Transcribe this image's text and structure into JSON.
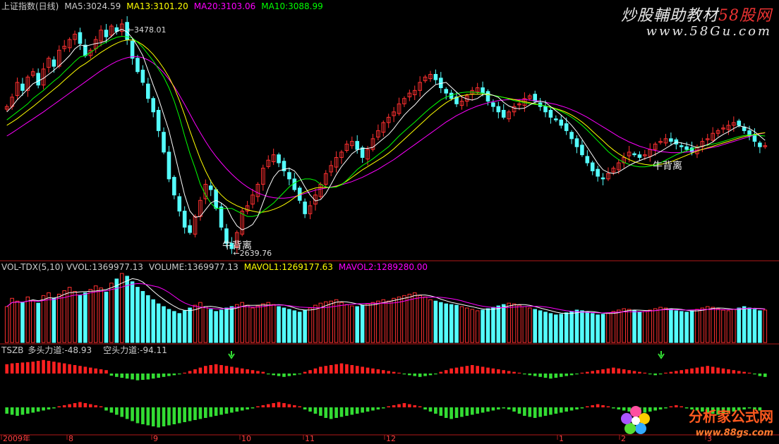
{
  "colors": {
    "up": "#ff3030",
    "down": "#54fcfc",
    "ma5": "#ffffff",
    "ma10": "#00ff00",
    "ma13": "#ffff00",
    "ma20": "#ff00ff",
    "bull": "#ff2020",
    "bear": "#33dd33",
    "arrow": "#33dd33",
    "separator": "#b01818"
  },
  "main_header": {
    "title": "上证指数(日线)",
    "ma5": "MA5:3024.59",
    "ma13": "MA13:3101.20",
    "ma20": "MA20:3103.06",
    "ma10": "MA10:3088.99"
  },
  "annotations": {
    "high": "3478.01",
    "low": "2639.76",
    "bull_div_1": "牛背离",
    "bull_div_2": "牛背离"
  },
  "vol_header": {
    "name": "VOL-TDX(5,10)",
    "vvol": "VVOL:1369977.13",
    "volume": "VOLUME:1369977.13",
    "mavol1": "MAVOL1:1269177.63",
    "mavol2": "MAVOL2:1289280.00"
  },
  "tszb_header": {
    "name": "TSZB",
    "bull": "多头力道:-48.93",
    "bear": "空头力道:-94.11"
  },
  "x_axis": {
    "labels": [
      "2009年",
      "8",
      "9",
      "10",
      "11",
      "12",
      "1",
      "2",
      "3"
    ]
  },
  "watermarks": {
    "brand_top": "炒股輔助教材",
    "brand_top_red": "58股网",
    "url_top": "www.58Gu.com",
    "brand_bottom": "分析家公式网",
    "url_bottom": "www.88gs.com"
  },
  "chart_data": {
    "type": "candlestick",
    "ylim": [
      2600,
      3520
    ],
    "high_point": 3478.01,
    "low_point": 2639.76,
    "closes": [
      3170,
      3205,
      3260,
      3230,
      3280,
      3300,
      3250,
      3310,
      3350,
      3320,
      3380,
      3395,
      3420,
      3440,
      3405,
      3360,
      3380,
      3420,
      3455,
      3430,
      3470,
      3450,
      3478,
      3420,
      3350,
      3300,
      3260,
      3200,
      3150,
      3080,
      3000,
      2900,
      2840,
      2780,
      2720,
      2700,
      2760,
      2820,
      2880,
      2860,
      2790,
      2720,
      2660,
      2640,
      2700,
      2780,
      2800,
      2840,
      2880,
      2940,
      2970,
      2990,
      2960,
      2930,
      2900,
      2860,
      2820,
      2770,
      2800,
      2840,
      2880,
      2920,
      2950,
      2980,
      3000,
      3030,
      3040,
      3010,
      2980,
      3010,
      3050,
      3080,
      3110,
      3130,
      3150,
      3180,
      3200,
      3220,
      3230,
      3260,
      3280,
      3290,
      3270,
      3240,
      3220,
      3200,
      3180,
      3190,
      3210,
      3230,
      3240,
      3220,
      3190,
      3170,
      3150,
      3130,
      3150,
      3170,
      3180,
      3200,
      3210,
      3190,
      3170,
      3150,
      3130,
      3120,
      3100,
      3080,
      3050,
      3020,
      2990,
      2960,
      2930,
      2910,
      2900,
      2920,
      2940,
      2960,
      2980,
      3000,
      2990,
      2980,
      2990,
      3010,
      3030,
      3040,
      3050,
      3040,
      3030,
      3020,
      3010,
      3000,
      3020,
      3040,
      3050,
      3070,
      3080,
      3090,
      3100,
      3110,
      3100,
      3080,
      3060,
      3040,
      3020,
      3024
    ],
    "ma5": [
      3150,
      3170,
      3195,
      3215,
      3235,
      3255,
      3265,
      3275,
      3290,
      3305,
      3322,
      3340,
      3360,
      3385,
      3400,
      3395,
      3400,
      3405,
      3408,
      3415,
      3432,
      3450,
      3458,
      3448,
      3425,
      3395,
      3360,
      3305,
      3250,
      3200,
      3140,
      3080,
      3000,
      2920,
      2840,
      2780,
      2757,
      2760,
      2785,
      2810,
      2820,
      2810,
      2795,
      2755,
      2725,
      2710,
      2718,
      2730,
      2760,
      2812,
      2865,
      2906,
      2930,
      2936,
      2940,
      2930,
      2905,
      2870,
      2840,
      2818,
      2823,
      2846,
      2880,
      2916,
      2946,
      2970,
      2994,
      3008,
      3014,
      3014,
      3018,
      3034,
      3050,
      3066,
      3088,
      3114,
      3138,
      3158,
      3176,
      3198,
      3218,
      3235,
      3252,
      3256,
      3260,
      3242,
      3224,
      3206,
      3198,
      3194,
      3200,
      3214,
      3218,
      3212,
      3204,
      3186,
      3172,
      3164,
      3162,
      3164,
      3176,
      3186,
      3190,
      3186,
      3170,
      3154,
      3138,
      3120,
      3100,
      3076,
      3048,
      3018,
      2988,
      2958,
      2934,
      2924,
      2920,
      2926,
      2938,
      2950,
      2960,
      2968,
      2976,
      2982,
      2992,
      3002,
      3014,
      3026,
      3038,
      3034,
      3030,
      3024,
      3016,
      3022,
      3028,
      3038,
      3054,
      3066,
      3076,
      3088,
      3098,
      3094,
      3088,
      3076,
      3060,
      3044
    ],
    "ma10": [
      3120,
      3135,
      3150,
      3165,
      3180,
      3200,
      3215,
      3230,
      3248,
      3265,
      3280,
      3300,
      3318,
      3338,
      3355,
      3360,
      3372,
      3385,
      3400,
      3410,
      3420,
      3428,
      3432,
      3430,
      3425,
      3410,
      3390,
      3365,
      3340,
      3310,
      3280,
      3240,
      3190,
      3130,
      3060,
      2995,
      2940,
      2880,
      2840,
      2810,
      2790,
      2790,
      2790,
      2790,
      2780,
      2770,
      2760,
      2760,
      2765,
      2780,
      2795,
      2810,
      2830,
      2850,
      2870,
      2885,
      2895,
      2900,
      2900,
      2895,
      2880,
      2870,
      2868,
      2870,
      2878,
      2895,
      2915,
      2935,
      2950,
      2962,
      2975,
      2990,
      3005,
      3020,
      3040,
      3060,
      3078,
      3095,
      3112,
      3130,
      3148,
      3165,
      3180,
      3195,
      3205,
      3212,
      3218,
      3222,
      3224,
      3224,
      3222,
      3220,
      3216,
      3212,
      3208,
      3204,
      3198,
      3192,
      3188,
      3184,
      3180,
      3178,
      3176,
      3172,
      3166,
      3160,
      3152,
      3142,
      3130,
      3116,
      3100,
      3082,
      3062,
      3042,
      3022,
      3002,
      2986,
      2972,
      2962,
      2954,
      2948,
      2945,
      2945,
      2948,
      2952,
      2960,
      2970,
      2980,
      2990,
      2998,
      3006,
      3012,
      3018,
      3022,
      3026,
      3030,
      3034,
      3040,
      3046,
      3052,
      3058,
      3062,
      3064,
      3064,
      3062,
      3060
    ],
    "ma13": [
      3100,
      3112,
      3125,
      3140,
      3155,
      3170,
      3186,
      3202,
      3218,
      3234,
      3250,
      3268,
      3285,
      3302,
      3318,
      3330,
      3344,
      3358,
      3372,
      3384,
      3396,
      3406,
      3414,
      3418,
      3418,
      3412,
      3400,
      3384,
      3364,
      3340,
      3312,
      3280,
      3240,
      3192,
      3138,
      3080,
      3026,
      2974,
      2930,
      2892,
      2862,
      2840,
      2822,
      2810,
      2800,
      2792,
      2785,
      2780,
      2776,
      2776,
      2780,
      2786,
      2794,
      2804,
      2816,
      2830,
      2842,
      2852,
      2860,
      2866,
      2868,
      2868,
      2868,
      2872,
      2880,
      2892,
      2906,
      2920,
      2934,
      2946,
      2958,
      2970,
      2982,
      2996,
      3012,
      3030,
      3048,
      3066,
      3084,
      3102,
      3120,
      3138,
      3154,
      3170,
      3184,
      3196,
      3204,
      3210,
      3214,
      3216,
      3216,
      3216,
      3214,
      3212,
      3208,
      3204,
      3200,
      3196,
      3192,
      3188,
      3184,
      3180,
      3176,
      3172,
      3168,
      3162,
      3156,
      3148,
      3138,
      3126,
      3112,
      3096,
      3078,
      3060,
      3042,
      3024,
      3008,
      2994,
      2982,
      2972,
      2964,
      2958,
      2954,
      2952,
      2952,
      2954,
      2958,
      2964,
      2972,
      2980,
      2988,
      2996,
      3004,
      3010,
      3016,
      3022,
      3028,
      3034,
      3040,
      3046,
      3052,
      3058,
      3062,
      3066,
      3070,
      3072
    ],
    "ma20": [
      3060,
      3072,
      3085,
      3098,
      3111,
      3124,
      3137,
      3150,
      3164,
      3178,
      3192,
      3206,
      3220,
      3234,
      3248,
      3262,
      3276,
      3290,
      3304,
      3316,
      3328,
      3338,
      3346,
      3352,
      3356,
      3356,
      3352,
      3344,
      3332,
      3316,
      3296,
      3272,
      3244,
      3212,
      3178,
      3142,
      3106,
      3072,
      3040,
      3010,
      2984,
      2960,
      2938,
      2918,
      2900,
      2884,
      2870,
      2858,
      2848,
      2840,
      2834,
      2830,
      2828,
      2828,
      2830,
      2834,
      2840,
      2846,
      2852,
      2858,
      2862,
      2866,
      2870,
      2874,
      2878,
      2884,
      2890,
      2898,
      2906,
      2916,
      2926,
      2936,
      2948,
      2960,
      2972,
      2986,
      3000,
      3014,
      3028,
      3042,
      3056,
      3070,
      3084,
      3098,
      3112,
      3124,
      3136,
      3146,
      3156,
      3164,
      3172,
      3178,
      3184,
      3188,
      3192,
      3194,
      3196,
      3196,
      3196,
      3196,
      3194,
      3192,
      3190,
      3186,
      3182,
      3178,
      3172,
      3166,
      3158,
      3150,
      3140,
      3130,
      3118,
      3106,
      3094,
      3082,
      3070,
      3058,
      3048,
      3038,
      3030,
      3022,
      3016,
      3010,
      3006,
      3002,
      3000,
      2998,
      2998,
      2998,
      3000,
      3002,
      3006,
      3010,
      3014,
      3018,
      3022,
      3028,
      3034,
      3040,
      3046,
      3052,
      3058,
      3064,
      3068,
      3072
    ],
    "volume": [
      52,
      64,
      60,
      58,
      66,
      61,
      57,
      68,
      72,
      64,
      70,
      75,
      80,
      74,
      68,
      72,
      77,
      82,
      79,
      73,
      86,
      92,
      100,
      96,
      88,
      80,
      74,
      68,
      62,
      56,
      52,
      48,
      45,
      42,
      46,
      50,
      54,
      58,
      52,
      48,
      45,
      47,
      50,
      52,
      55,
      58,
      54,
      50,
      53,
      56,
      58,
      55,
      52,
      50,
      48,
      46,
      44,
      47,
      50,
      54,
      57,
      59,
      60,
      62,
      58,
      55,
      53,
      52,
      54,
      56,
      58,
      60,
      62,
      60,
      64,
      66,
      68,
      70,
      72,
      68,
      66,
      62,
      60,
      58,
      56,
      55,
      54,
      52,
      50,
      48,
      46,
      47,
      49,
      51,
      53,
      55,
      57,
      56,
      54,
      52,
      50,
      48,
      46,
      44,
      42,
      40,
      41,
      43,
      45,
      47,
      46,
      44,
      42,
      40,
      41,
      43,
      45,
      47,
      49,
      48,
      46,
      44,
      45,
      47,
      49,
      51,
      50,
      48,
      46,
      45,
      44,
      46,
      48,
      50,
      52,
      51,
      49,
      47,
      46,
      48,
      50,
      52,
      50,
      48,
      46,
      47
    ],
    "bull_force": [
      22,
      24,
      25,
      26,
      27,
      28,
      30,
      32,
      30,
      28,
      26,
      24,
      22,
      20,
      18,
      16,
      14,
      12,
      10,
      8,
      -5,
      -8,
      -10,
      -12,
      -14,
      -16,
      -15,
      -14,
      -12,
      -10,
      -8,
      -6,
      -4,
      -2,
      2,
      6,
      10,
      14,
      18,
      20,
      22,
      20,
      18,
      16,
      14,
      12,
      10,
      8,
      6,
      4,
      -2,
      -4,
      -6,
      -8,
      -6,
      -4,
      -2,
      4,
      8,
      12,
      16,
      18,
      20,
      22,
      24,
      22,
      20,
      18,
      16,
      14,
      12,
      10,
      8,
      6,
      4,
      2,
      -2,
      -4,
      -6,
      -8,
      -6,
      -4,
      -2,
      4,
      8,
      12,
      14,
      16,
      18,
      20,
      18,
      16,
      14,
      12,
      10,
      8,
      6,
      4,
      2,
      -2,
      -4,
      -6,
      -8,
      -10,
      -12,
      -10,
      -8,
      -6,
      -4,
      -2,
      2,
      4,
      6,
      8,
      10,
      12,
      14,
      12,
      10,
      8,
      6,
      4,
      2,
      -2,
      -4,
      -2,
      2,
      4,
      6,
      8,
      10,
      12,
      14,
      16,
      18,
      16,
      14,
      12,
      10,
      8,
      6,
      4,
      2,
      -2,
      -6,
      -8,
      -10
    ],
    "bear_force": [
      -12,
      -14,
      -16,
      -14,
      -12,
      -10,
      -8,
      -6,
      -4,
      -2,
      2,
      4,
      6,
      8,
      10,
      8,
      6,
      4,
      2,
      -6,
      -10,
      -14,
      -18,
      -22,
      -26,
      -30,
      -32,
      -34,
      -36,
      -38,
      -36,
      -34,
      -32,
      -30,
      -28,
      -26,
      -24,
      -22,
      -20,
      -18,
      -16,
      -14,
      -12,
      -10,
      -8,
      -6,
      -4,
      -2,
      2,
      4,
      6,
      8,
      10,
      8,
      6,
      4,
      2,
      -4,
      -8,
      -12,
      -16,
      -20,
      -22,
      -20,
      -18,
      -16,
      -14,
      -12,
      -10,
      -8,
      -6,
      -4,
      -2,
      2,
      4,
      6,
      8,
      6,
      4,
      2,
      -4,
      -8,
      -12,
      -16,
      -20,
      -22,
      -20,
      -18,
      -16,
      -14,
      -12,
      -10,
      -8,
      -6,
      -4,
      -2,
      -4,
      -8,
      -12,
      -16,
      -18,
      -20,
      -18,
      -16,
      -14,
      -12,
      -10,
      -8,
      -6,
      -4,
      -2,
      2,
      4,
      6,
      4,
      2,
      -2,
      -4,
      -6,
      -8,
      -10,
      -12,
      -10,
      -8,
      -6,
      -4,
      -2,
      2,
      4,
      2,
      -2,
      -4,
      -6,
      -8,
      -10,
      -12,
      -14,
      -12,
      -10,
      -8,
      -6,
      -4,
      -2,
      -4,
      -6
    ]
  }
}
